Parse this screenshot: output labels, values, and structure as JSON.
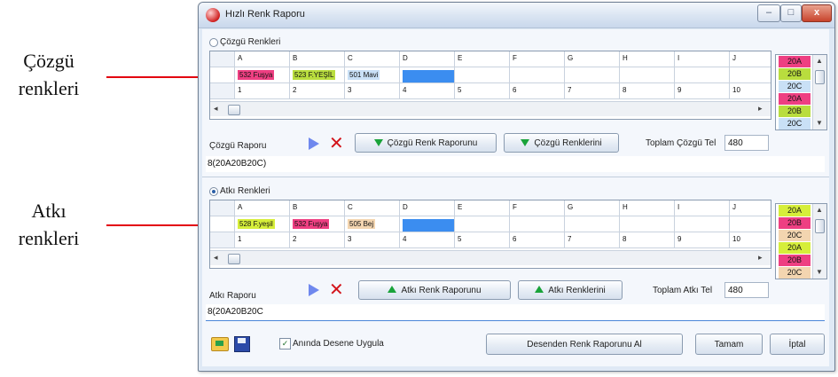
{
  "annotations": {
    "warp_line1": "Çözgü",
    "warp_line2": "renkleri",
    "weft_line1": "Atkı",
    "weft_line2": "renkleri"
  },
  "window": {
    "title": "Hızlı Renk Raporu",
    "btn_min": "–",
    "btn_max": "□",
    "btn_close": "x"
  },
  "warp": {
    "section_label": "Çözgü Renkleri",
    "selected": false,
    "columns": [
      "A",
      "B",
      "C",
      "D",
      "E",
      "F",
      "G",
      "H",
      "I",
      "J"
    ],
    "colors": [
      {
        "label": "532 Fuşya",
        "bg": "#ee3f82"
      },
      {
        "label": "523 F.YEŞİL",
        "bg": "#b9dd3e"
      },
      {
        "label": "501 Mavi",
        "bg": "#c9e0f6"
      },
      {
        "label": "",
        "bg": "#3b8df0"
      },
      {
        "label": "",
        "bg": ""
      },
      {
        "label": "",
        "bg": ""
      },
      {
        "label": "",
        "bg": ""
      },
      {
        "label": "",
        "bg": ""
      },
      {
        "label": "",
        "bg": ""
      },
      {
        "label": "",
        "bg": ""
      }
    ],
    "numbers": [
      "1",
      "2",
      "3",
      "4",
      "5",
      "6",
      "7",
      "8",
      "9",
      "10"
    ],
    "side_list": [
      {
        "label": "20A",
        "bg": "#ee3f82"
      },
      {
        "label": "20B",
        "bg": "#b9dd3e"
      },
      {
        "label": "20C",
        "bg": "#c9e0f6"
      },
      {
        "label": "20A",
        "bg": "#ee3f82"
      },
      {
        "label": "20B",
        "bg": "#b9dd3e"
      },
      {
        "label": "20C",
        "bg": "#c9e0f6"
      }
    ],
    "report_label": "Çözgü Raporu",
    "btn_report": "Çözgü Renk Raporunu",
    "btn_colors": "Çözgü Renklerini",
    "total_label": "Toplam Çözgü Tel",
    "total_value": "480",
    "report_value": "8(20A20B20C)"
  },
  "weft": {
    "section_label": "Atkı Renkleri",
    "selected": true,
    "columns": [
      "A",
      "B",
      "C",
      "D",
      "E",
      "F",
      "G",
      "H",
      "I",
      "J"
    ],
    "colors": [
      {
        "label": "528 F.yeşil",
        "bg": "#d6ee3a"
      },
      {
        "label": "532 Fuşya",
        "bg": "#ee3f82"
      },
      {
        "label": "505 Bej",
        "bg": "#f3d5b0"
      },
      {
        "label": "",
        "bg": "#3b8df0"
      },
      {
        "label": "",
        "bg": ""
      },
      {
        "label": "",
        "bg": ""
      },
      {
        "label": "",
        "bg": ""
      },
      {
        "label": "",
        "bg": ""
      },
      {
        "label": "",
        "bg": ""
      },
      {
        "label": "",
        "bg": ""
      }
    ],
    "numbers": [
      "1",
      "2",
      "3",
      "4",
      "5",
      "6",
      "7",
      "8",
      "9",
      "10"
    ],
    "side_list": [
      {
        "label": "20A",
        "bg": "#d6ee3a"
      },
      {
        "label": "20B",
        "bg": "#ee3f82"
      },
      {
        "label": "20C",
        "bg": "#f3d5b0"
      },
      {
        "label": "20A",
        "bg": "#d6ee3a"
      },
      {
        "label": "20B",
        "bg": "#ee3f82"
      },
      {
        "label": "20C",
        "bg": "#f3d5b0"
      }
    ],
    "report_label": "Atkı Raporu",
    "btn_report": "Atkı Renk Raporunu",
    "btn_colors": "Atkı Renklerini",
    "total_label": "Toplam Atkı Tel",
    "total_value": "480",
    "report_value": "8(20A20B20C"
  },
  "footer": {
    "apply_label": "Anında Desene Uygula",
    "apply_checked": true,
    "btn_get_report": "Desenden Renk Raporunu Al",
    "btn_ok": "Tamam",
    "btn_cancel": "İptal"
  }
}
